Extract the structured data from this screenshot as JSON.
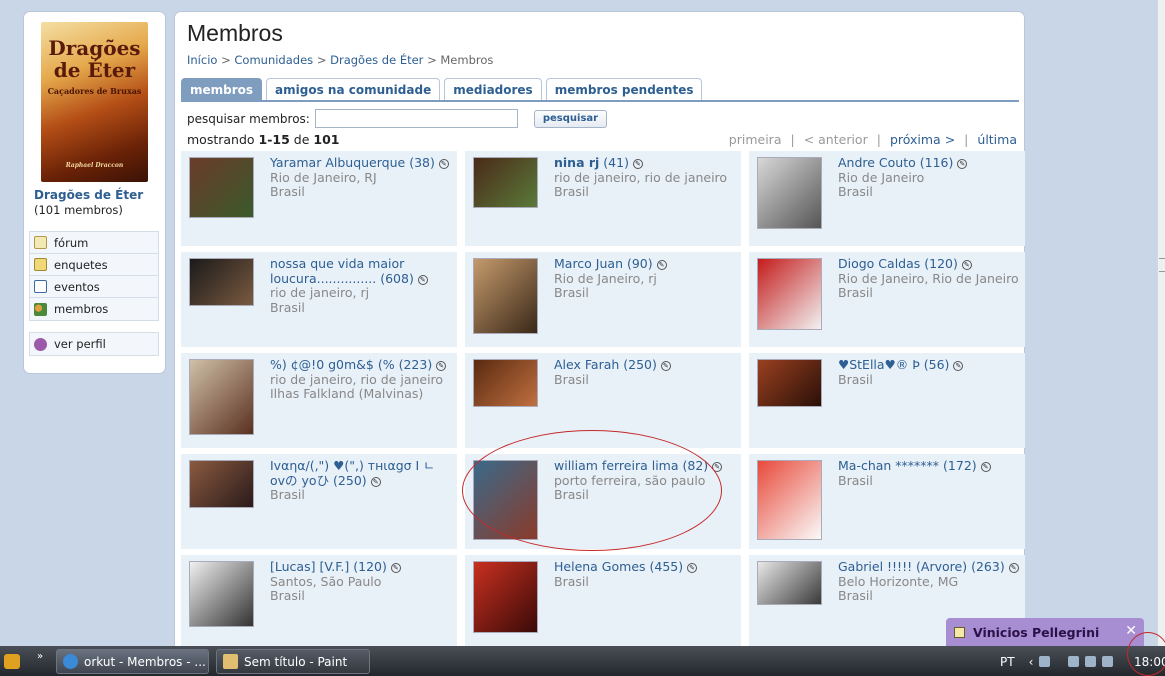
{
  "community": {
    "name": "Dragões de Éter",
    "count_text": "(101 membros)",
    "cover": {
      "line1": "Dragões",
      "line2": "de Éter",
      "subtitle": "Caçadores de Bruxas",
      "author": "Raphael Draccon"
    }
  },
  "sidebar": {
    "items": [
      {
        "label": "fórum",
        "icon": "forum-icon"
      },
      {
        "label": "enquetes",
        "icon": "poll-icon"
      },
      {
        "label": "eventos",
        "icon": "calendar-icon"
      },
      {
        "label": "membros",
        "icon": "members-icon"
      }
    ],
    "profile": {
      "label": "ver perfil",
      "icon": "profile-icon"
    }
  },
  "header": {
    "title": "Membros",
    "breadcrumb": [
      "Início",
      "Comunidades",
      "Dragões de Éter",
      "Membros"
    ],
    "separator": ">"
  },
  "tabs": [
    "membros",
    "amigos na comunidade",
    "mediadores",
    "membros pendentes"
  ],
  "search": {
    "label": "pesquisar membros:",
    "value": "",
    "button": "pesquisar"
  },
  "showing": {
    "prefix": "mostrando",
    "range": "1-15",
    "of": "de",
    "total": "101"
  },
  "pager": {
    "first": "primeira",
    "prev": "< anterior",
    "next": "próxima >",
    "last": "última",
    "sep": "|"
  },
  "members": [
    {
      "name": "Yaramar Albuquerque",
      "count": "(38)",
      "loc1": "Rio de Janeiro, RJ",
      "loc2": "Brasil",
      "thumb": [
        "#6b3b2a",
        "#3a5a2a"
      ]
    },
    {
      "name": "nina rj",
      "count": "(41)",
      "loc1": "rio de janeiro, rio de janeiro",
      "loc2": "Brasil",
      "thumb": [
        "#4a2a18",
        "#5a7a3a"
      ]
    },
    {
      "name": "Andre Couto",
      "count": "(116)",
      "loc1": "Rio de Janeiro",
      "loc2": "Brasil",
      "thumb": [
        "#d8d8d8",
        "#555555"
      ]
    },
    {
      "name": "nossa que vida maior loucura...............",
      "count": "(608)",
      "loc1": "rio de janeiro, rj",
      "loc2": "Brasil",
      "thumb": [
        "#1a1a1a",
        "#7a5a40"
      ]
    },
    {
      "name": "Marco Juan",
      "count": "(90)",
      "loc1": "Rio de Janeiro, rj",
      "loc2": "Brasil",
      "thumb": [
        "#c49a6c",
        "#3a2818"
      ]
    },
    {
      "name": "Diogo Caldas",
      "count": "(120)",
      "loc1": "Rio de Janeiro, Rio de Janeiro",
      "loc2": "Brasil",
      "thumb": [
        "#c41c1c",
        "#f2f2f2"
      ]
    },
    {
      "name": "%) ¢@!0 g0m&$ (%",
      "count": "(223)",
      "loc1": "rio de janeiro, rio de janeiro",
      "loc2": "Ilhas Falkland (Malvinas)",
      "thumb": [
        "#d0c0a8",
        "#5a3020"
      ]
    },
    {
      "name": "Alex Farah",
      "count": "(250)",
      "loc1": "Brasil",
      "loc2": "",
      "thumb": [
        "#5a2a10",
        "#c07040"
      ]
    },
    {
      "name": "♥StElla♥® Þ",
      "count": "(56)",
      "loc1": "Brasil",
      "loc2": "",
      "thumb": [
        "#9a4020",
        "#2a1008"
      ]
    },
    {
      "name": "Ivαηα/(,\") ♥(\",) тнιαgσ I ㄴ ovの yoひ",
      "count": "(250)",
      "loc1": "Brasil",
      "loc2": "",
      "thumb": [
        "#8a5a40",
        "#2a1a1a"
      ]
    },
    {
      "name": "william ferreira lima",
      "count": "(82)",
      "loc1": "porto ferreira, são paulo",
      "loc2": "Brasil",
      "thumb": [
        "#3a6a8a",
        "#8a3a2a"
      ]
    },
    {
      "name": "Ma-chan *******",
      "count": "(172)",
      "loc1": "",
      "loc2": "Brasil",
      "thumb": [
        "#e84a3a",
        "#fafafa"
      ]
    },
    {
      "name": "[Lucas] [V.F.]",
      "count": "(120)",
      "loc1": "Santos, São Paulo",
      "loc2": "Brasil",
      "thumb": [
        "#f0f0f0",
        "#333333"
      ]
    },
    {
      "name": "Helena Gomes",
      "count": "(455)",
      "loc1": "Brasil",
      "loc2": "",
      "thumb": [
        "#c83020",
        "#3a0a08"
      ]
    },
    {
      "name": "Gabriel !!!!! (Arvore)",
      "count": "(263)",
      "loc1": "Belo Horizonte, MG",
      "loc2": "Brasil",
      "thumb": [
        "#e8e8e8",
        "#3a3a3a"
      ]
    }
  ],
  "notification": {
    "name": "Vinicios Pellegrini",
    "close": "✕"
  },
  "taskbar": {
    "tasks": [
      {
        "label": "orkut - Membros - ...",
        "icon": "ie-icon"
      },
      {
        "label": "Sem título - Paint",
        "icon": "paint-icon"
      }
    ],
    "lang": "PT",
    "clock": "18:00",
    "expand": "»"
  },
  "colors": {
    "accent": "#2d5f92",
    "tab_active": "#7f9dbf",
    "card_bg": "#e8f0f8",
    "annotation": "#c62828"
  }
}
